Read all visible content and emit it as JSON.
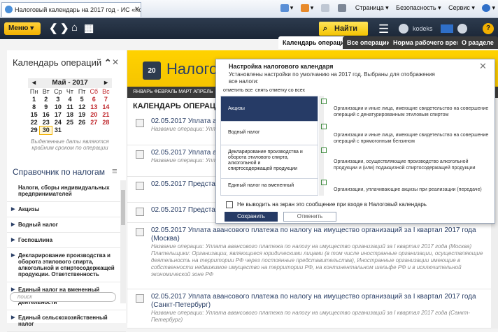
{
  "browser": {
    "tab_title": "Налоговый календарь на 2017 год - ИС «Кодекс: ...",
    "tab_close": "✕",
    "tools": [
      "▾",
      "▾",
      "Страница ▾",
      "Безопасность ▾",
      "Сервис ▾",
      "▾"
    ]
  },
  "toolbar": {
    "menu_label": "Меню ▾",
    "back": "❮",
    "forward": "❯",
    "home": "⌂",
    "grid": "▦",
    "search_label": "Найти",
    "hamburger": "☰",
    "user_name": "kodeks",
    "help": "?",
    "accent": "#f2b000",
    "dark": "#1b2636"
  },
  "tabs": [
    {
      "label": "Календарь операций"
    },
    {
      "label": "Все операции"
    },
    {
      "label": "Норма рабочего времени"
    },
    {
      "label": "О разделе"
    }
  ],
  "sidebar": {
    "calendar_title": "Календарь операций",
    "calendar_toggle": "⌃",
    "calendar_close": "✕",
    "month": "Май - 2017",
    "prev": "◂",
    "next": "▸",
    "weekdays": [
      "Пн",
      "Вт",
      "Ср",
      "Чт",
      "Пт",
      "Сб",
      "Вс"
    ],
    "calendar_note": "Выделенные даты являются крайним сроком по операции",
    "reference_title": "Справочник по налогам",
    "reference_menu": "≡",
    "items": [
      {
        "label": "Налоги, сборы индивидуальных предпринимателей"
      },
      {
        "label": "Акцизы"
      },
      {
        "label": "Водный налог"
      },
      {
        "label": "Госпошлина"
      },
      {
        "label": "Декларирование производства и оборота этилового спирта, алкогольной и спиртосодержащей продукции. Ответственность"
      },
      {
        "label": "Единый налог на вмененный доход для отдельных видов деятельности"
      },
      {
        "label": "Единый сельскохозяйственный налог"
      }
    ],
    "search_placeholder": "поиск"
  },
  "main": {
    "banner_title": "Налоговый",
    "banner_day": "20",
    "months": "ЯНВАРЬ   ФЕВРАЛЬ   МАРТ   АПРЕЛЬ",
    "ops_heading": "КАЛЕНДАРЬ ОПЕРАЦИЙ:",
    "events": [
      {
        "title": "02.05.2017 Уплата ава",
        "desc": "Название операции: Упл Плательщики: Организ (бессрочного) пользова"
      },
      {
        "title": "02.05.2017 Уплата ава",
        "desc": "Название операции: Упл Плательщики: Организ (бессрочного) пользова"
      },
      {
        "title": "02.05.2017 Представл 2016 год",
        "desc": ""
      },
      {
        "title": "02.05.2017 Представл",
        "desc": ""
      },
      {
        "title": "02.05.2017 Уплата авансового платежа по налогу на имущество организаций за I квартал 2017 года (Москва)",
        "desc": "Название операции: Уплата авансового платежа по налогу на имущество организаций за I квартал 2017 года (Москва) Плательщики: Организации, являющиеся юридическими лицами (в том числе иностранные организации, осуществляющие деятельность на территории РФ через постоянные представительства), Иностранные организации имеющие в собственности недвижимое имущество на территории РФ, на континентальном шельфе РФ и в исключительной экономической зоне РФ"
      },
      {
        "title": "02.05.2017 Уплата авансового платежа по налогу на имущество организаций за I квартал 2017 года (Санкт-Петербург)",
        "desc": "Название операции: Уплата авансового платежа по налогу на имущество организаций за I квартал 2017 года (Санкт-Петербург)"
      }
    ]
  },
  "dialog": {
    "title": "Настройка налогового календаря",
    "subtitle": "Установлены настройки по умолчанию на 2017 год. Выбраны для отображения все налоги:",
    "close": "✕",
    "mark_all": "отметить все",
    "unmark_all": "снять отметку со всех",
    "items": [
      {
        "label": "Акцизы",
        "desc": "Организации и иные лица, имеющие свидетельство на совершение операций с денатурированным этиловым спиртом"
      },
      {
        "label": "Водный налог",
        "desc": "Организации и иные лица, имеющие свидетельство на совершение операций с прямогонным бензином"
      },
      {
        "label": "Декларирование производства и оборота этилового спирта, алкогольной и спиртосодержащей продукции",
        "desc": "Организации, осуществляющие производство алкогольной продукции и (или) подакцизной спиртосодержащей продукции"
      },
      {
        "label": "Единый налог на вмененный",
        "desc": "Организации, уплачивающие акцизы при реализации (передаче)"
      }
    ],
    "no_show": "Не выводить на экран это сообщение при входе в Налоговый календарь",
    "save": "Сохранить",
    "cancel": "Отменить"
  }
}
